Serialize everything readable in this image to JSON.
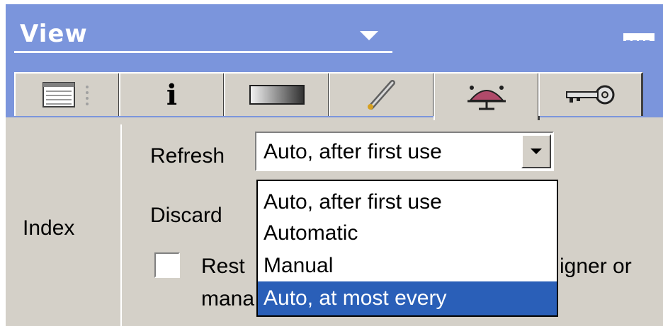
{
  "header": {
    "title": "View"
  },
  "tabs": [
    {
      "name": "list-view",
      "icon": "list-icon"
    },
    {
      "name": "info",
      "icon": "info-icon",
      "glyph": "i"
    },
    {
      "name": "gradient",
      "icon": "gradient-icon"
    },
    {
      "name": "brush",
      "icon": "brush-icon"
    },
    {
      "name": "cluster",
      "icon": "cluster-icon"
    },
    {
      "name": "key",
      "icon": "key-icon"
    }
  ],
  "sidebar": {
    "label": "Index"
  },
  "form": {
    "refresh_label": "Refresh",
    "refresh_value": "Auto, after first use",
    "discard_label": "Discard",
    "restrict_text_left": "Rest",
    "restrict_text_right": "igner or",
    "restrict_text_line2": "mana",
    "restrict_checked": false
  },
  "dropdown": {
    "options": [
      "Auto, after first use",
      "Automatic",
      "Manual",
      "Auto, at most every"
    ],
    "selected_index": 3
  },
  "colors": {
    "titlebar": "#7b95dc",
    "panel": "#d4d0c8",
    "selection": "#2a5fb8"
  }
}
